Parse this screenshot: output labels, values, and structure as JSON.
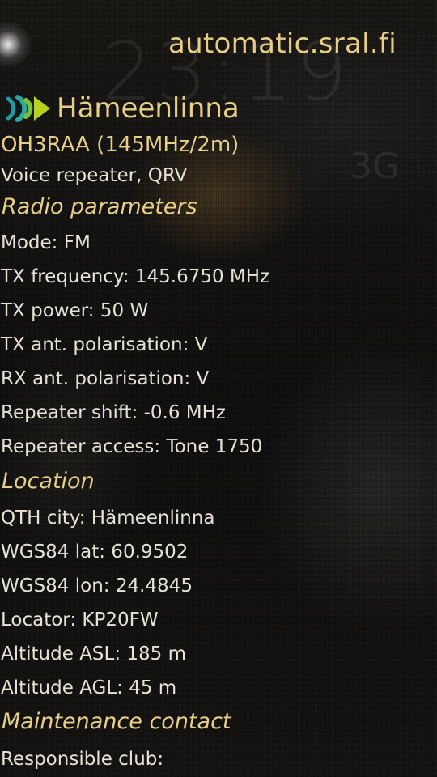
{
  "site": "automatic.sral.fi",
  "repeater": {
    "city": "Hämeenlinna",
    "callsign": "OH3RAA (145MHz/2m)",
    "type": "Voice repeater, QRV"
  },
  "sections": {
    "radio": "Radio parameters",
    "location": "Location",
    "maintenance": "Maintenance contact"
  },
  "radio_params": [
    "Mode: FM",
    "TX frequency: 145.6750 MHz",
    "TX power: 50 W",
    "TX ant. polarisation: V",
    "RX ant. polarisation: V",
    "Repeater shift: -0.6 MHz",
    "Repeater access: Tone 1750"
  ],
  "location_params": [
    "QTH city: Hämeenlinna",
    "WGS84 lat: 60.9502",
    "WGS84 lon: 24.4845",
    "Locator: KP20FW",
    "Altitude ASL: 185 m",
    "Altitude AGL: 45 m"
  ],
  "maintenance_params": [
    "Responsible club:"
  ],
  "colors": {
    "accent": "#e7cf87",
    "text": "#e6e2da",
    "logo_teal": "#1f9aa5",
    "logo_green": "#b6d11f"
  },
  "icons": {
    "logo": "repeater-signal-icon"
  }
}
